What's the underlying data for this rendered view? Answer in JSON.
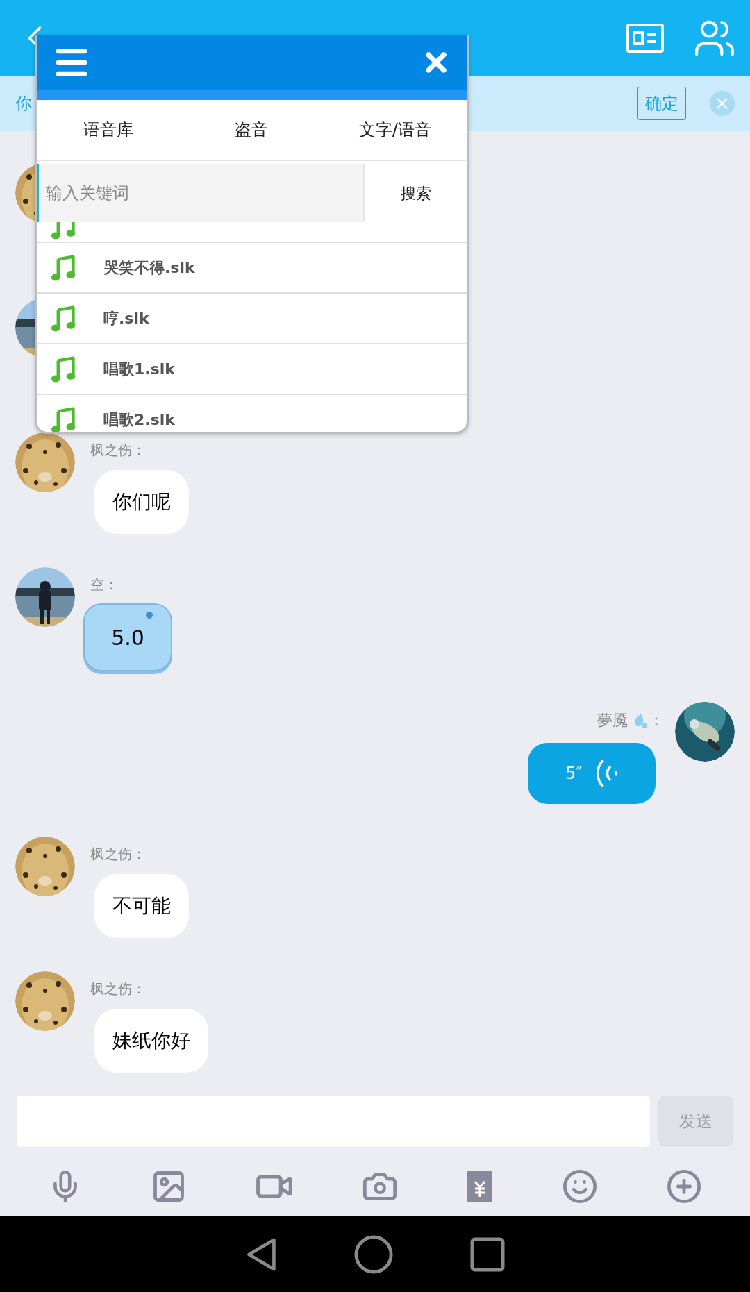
{
  "notice": {
    "text": "你",
    "confirm": "确定"
  },
  "popup": {
    "tabs": [
      {
        "label": "语音库",
        "selected": false
      },
      {
        "label": "盗音",
        "selected": false
      },
      {
        "label": "文字/语音",
        "selected": false
      }
    ],
    "search": {
      "placeholder": "输入关键词",
      "button": "搜索"
    },
    "files": [
      {
        "name": "哭笑不得.slk"
      },
      {
        "name": "哼.slk"
      },
      {
        "name": "唱歌1.slk"
      },
      {
        "name": "唱歌2.slk"
      }
    ]
  },
  "messages": [
    {
      "kind": "covered",
      "outgoing": false
    },
    {
      "kind": "covered",
      "outgoing": false
    },
    {
      "kind": "text",
      "outgoing": false,
      "sender": "枫之伤：",
      "text": "你们呢"
    },
    {
      "kind": "sticker",
      "outgoing": false,
      "sender": "空：",
      "text": "5.0"
    },
    {
      "kind": "voice",
      "outgoing": true,
      "sender": "夢魇",
      "sender_suffix": "：",
      "text": "5″"
    },
    {
      "kind": "text",
      "outgoing": false,
      "sender": "枫之伤：",
      "text": "不可能"
    },
    {
      "kind": "text",
      "outgoing": false,
      "sender": "枫之伤：",
      "text": "妹纸你好"
    }
  ],
  "composer": {
    "send": "发送",
    "send_disabled": true
  }
}
